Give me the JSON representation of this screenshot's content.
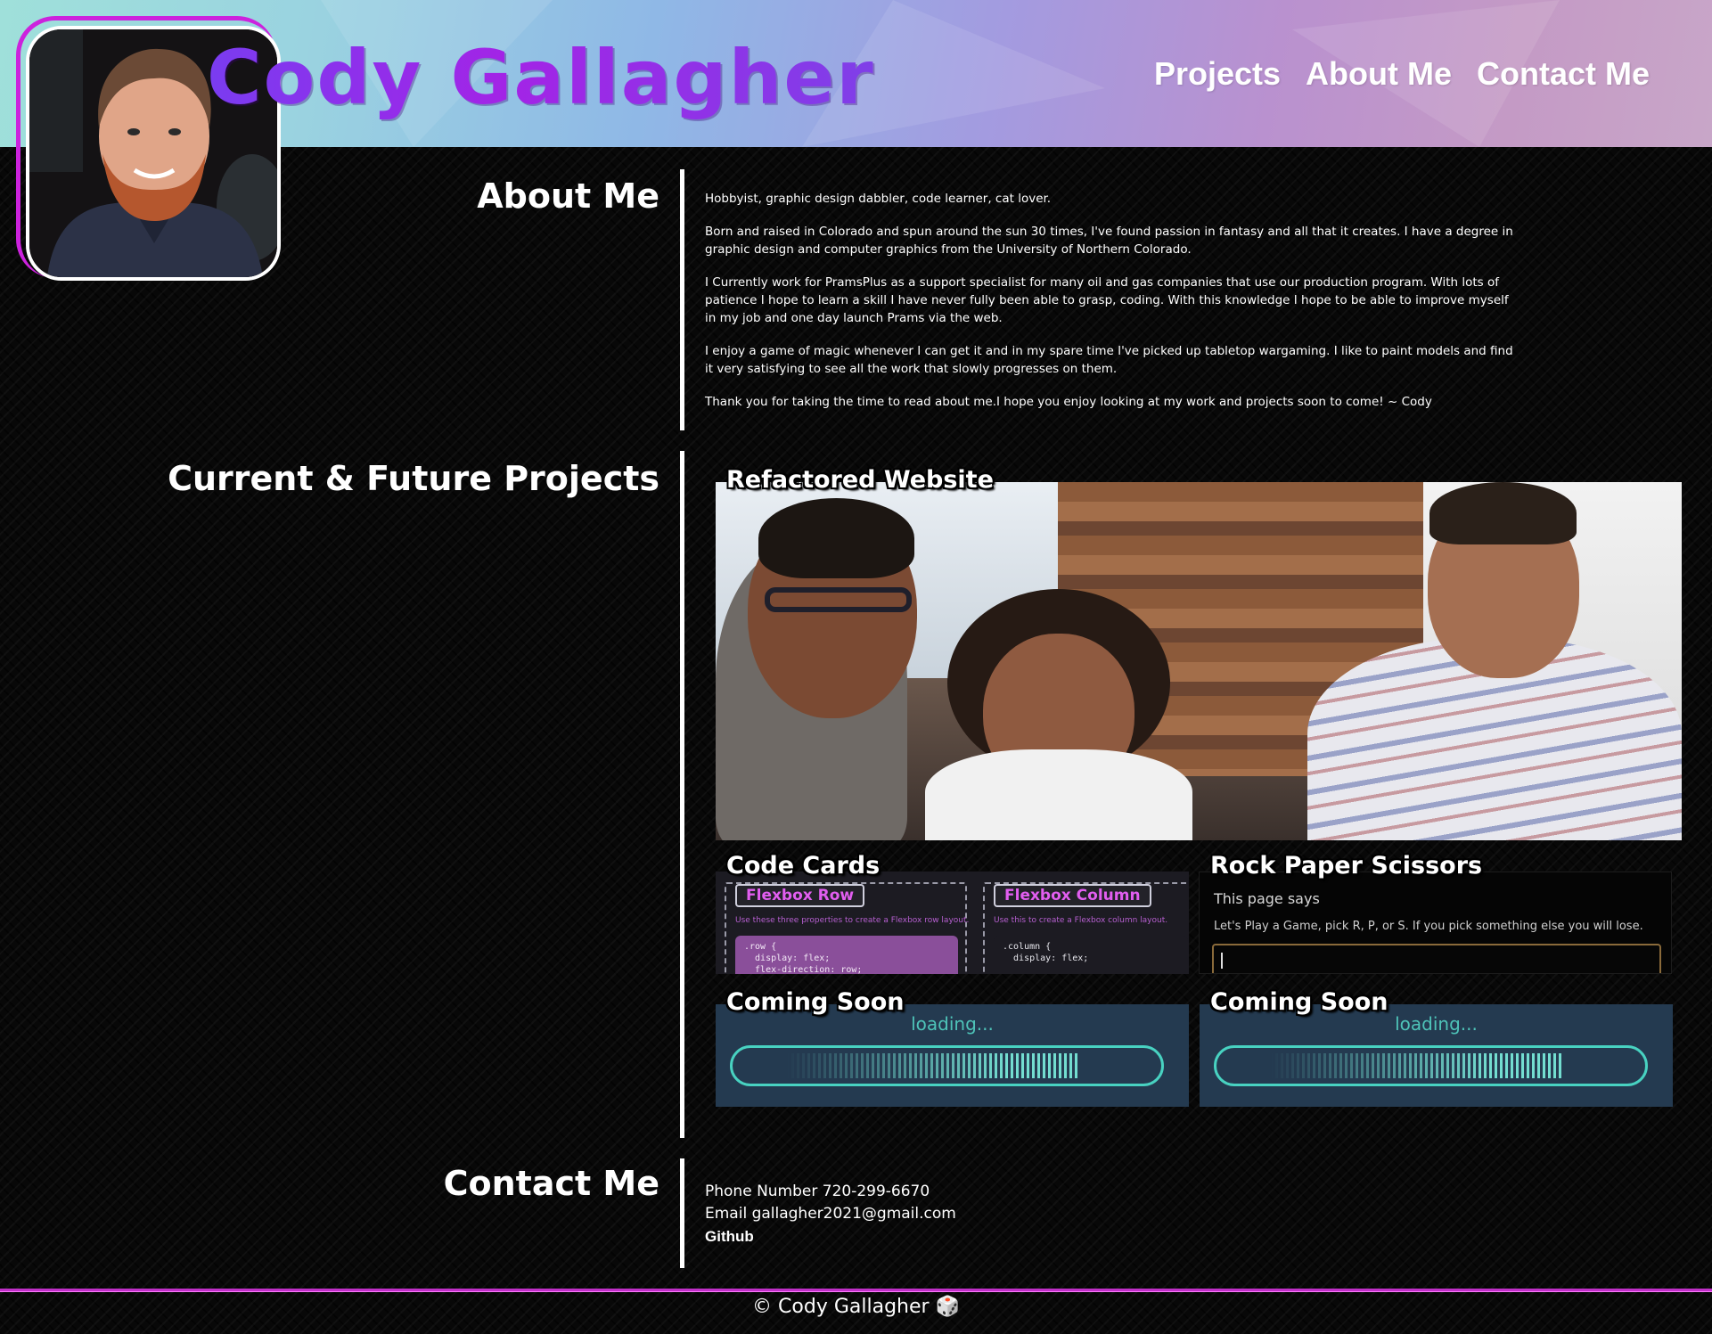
{
  "header": {
    "brand": "Cody Gallagher",
    "nav": [
      "Projects",
      "About Me",
      "Contact Me"
    ]
  },
  "about": {
    "title": "About Me",
    "paragraphs": [
      "Hobbyist, graphic design dabbler, code learner, cat lover.",
      "Born and raised in Colorado and spun around the sun 30 times, I've found passion in fantasy and all that it creates. I have a degree in graphic design and computer graphics from the University of Northern Colorado.",
      "I Currently work for PramsPlus as a support specialist for many oil and gas companies that use our production program. With lots of patience I hope to learn a skill I have never fully been able to grasp, coding. With this knowledge I hope to be able to improve myself in my job and one day launch Prams via the web.",
      "I enjoy a game of magic whenever I can get it and in my spare time I've picked up tabletop wargaming. I like to paint models and find it very satisfying to see all the work that slowly progresses on them.",
      "Thank you for taking the time to read about me.I hope you enjoy looking at my work and projects soon to come! ~ Cody"
    ]
  },
  "projects": {
    "title": "Current & Future Projects",
    "items": [
      {
        "title": "Refactored Website"
      },
      {
        "title": "Code Cards",
        "panels": [
          {
            "head": "Flexbox Row",
            "desc": "Use these three properties to create a Flexbox row layout.",
            "code": ".row {\n  display: flex;\n  flex-direction: row;"
          },
          {
            "head": "Flexbox Column",
            "desc": "Use this to create a Flexbox column layout.",
            "code": ".column {\n  display: flex;"
          }
        ]
      },
      {
        "title": "Rock Paper Scissors",
        "dialog_title": "This page says",
        "dialog_message": "Let's Play a Game, pick R, P, or S. If you pick something else you will lose."
      },
      {
        "title": "Coming Soon",
        "status": "loading..."
      },
      {
        "title": "Coming Soon",
        "status": "loading..."
      }
    ]
  },
  "contact": {
    "title": "Contact Me",
    "phone": "Phone Number 720-299-6670",
    "email": "Email gallagher2021@gmail.com",
    "github": "Github"
  },
  "footer": {
    "text": "© Cody Gallagher 🎲"
  },
  "colors": {
    "accent": "#c02fc8",
    "brand": "#8a2be2",
    "loading": "#48d2c1"
  }
}
